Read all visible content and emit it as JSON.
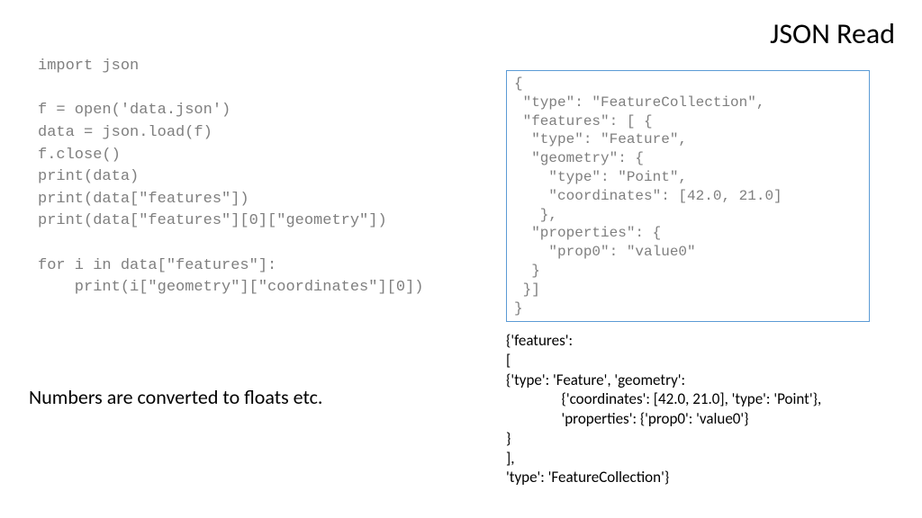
{
  "title": "JSON Read",
  "code_left": "import json\n\nf = open('data.json')\ndata = json.load(f)\nf.close()\nprint(data)\nprint(data[\"features\"])\nprint(data[\"features\"][0][\"geometry\"])\n\nfor i in data[\"features\"]:\n    print(i[\"geometry\"][\"coordinates\"][0])",
  "note": "Numbers are converted to floats etc.",
  "json_box": "{\n \"type\": \"FeatureCollection\",\n \"features\": [ {\n  \"type\": \"Feature\",\n  \"geometry\": {\n    \"type\": \"Point\",\n    \"coordinates\": [42.0, 21.0]\n   },\n  \"properties\": {\n    \"prop0\": \"value0\"\n  }\n }]\n}",
  "output_right": "{'features':\n[\n{'type': 'Feature', 'geometry':\n                {'coordinates': [42.0, 21.0], 'type': 'Point'},\n                'properties': {'prop0': 'value0'}\n}\n],\n'type': 'FeatureCollection'}"
}
